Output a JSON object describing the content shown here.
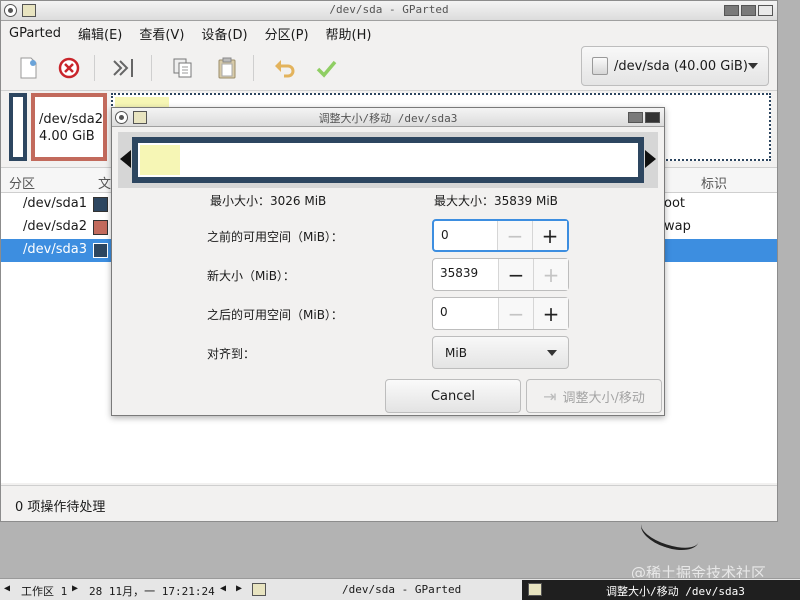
{
  "window": {
    "title": "/dev/sda - GParted"
  },
  "menubar": [
    "GParted",
    "编辑(E)",
    "查看(V)",
    "设备(D)",
    "分区(P)",
    "帮助(H)"
  ],
  "toolbar": {
    "icons": [
      "new-partition-icon",
      "delete-partition-icon",
      "resize-move-icon",
      "copy-icon",
      "paste-icon",
      "undo-icon",
      "apply-icon"
    ],
    "device_label": "/dev/sda (40.00 GiB)"
  },
  "disk_map": {
    "sda2_name": "/dev/sda2",
    "sda2_size": "4.00 GiB"
  },
  "list": {
    "columns": {
      "partition": "分区",
      "filesystem": "文",
      "label": "标识"
    },
    "rows": [
      {
        "name": "/dev/sda1",
        "color": "#2d4660",
        "flag": "oot"
      },
      {
        "name": "/dev/sda2",
        "color": "#c26a5c",
        "flag": "wap"
      },
      {
        "name": "/dev/sda3",
        "color": "#2d4660",
        "flag": ""
      }
    ]
  },
  "status": "0 项操作待处理",
  "dialog": {
    "title": "调整大小/移动 /dev/sda3",
    "min_size": "最小大小：3026 MiB",
    "max_size": "最大大小：35839 MiB",
    "free_before_label": "之前的可用空间（MiB）：",
    "free_before_value": "0",
    "new_size_label": "新大小（MiB）：",
    "new_size_value": "35839",
    "free_after_label": "之后的可用空间（MiB）：",
    "free_after_value": "0",
    "align_label": "对齐到：",
    "align_value": "MiB",
    "cancel_label": "Cancel",
    "resize_label": "调整大小/移动"
  },
  "taskbar": {
    "workspace": "工作区 1",
    "datetime": "28 11月，一 17:21:24",
    "task_title": "/dev/sda - GParted",
    "active_task_title": "调整大小/移动 /dev/sda3"
  },
  "watermark": "@稀土掘金技术社区"
}
